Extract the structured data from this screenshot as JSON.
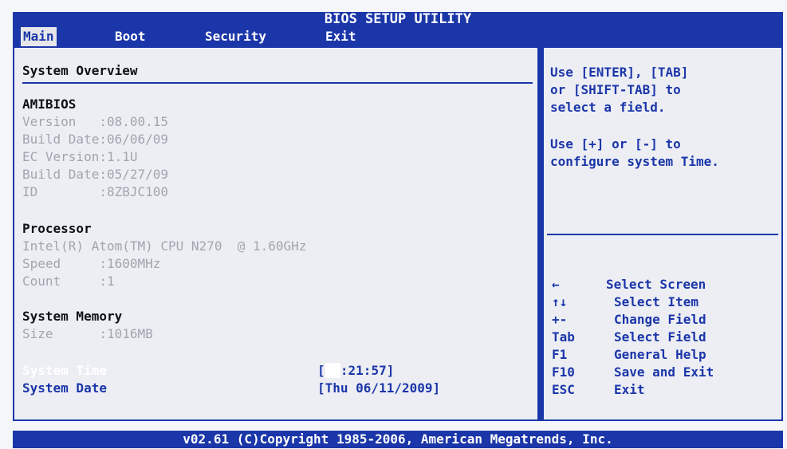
{
  "title": "BIOS SETUP UTILITY",
  "menu": [
    {
      "label": "Main"
    },
    {
      "label": "Boot"
    },
    {
      "label": "Security"
    },
    {
      "label": "Exit"
    }
  ],
  "overview": {
    "heading": "System Overview",
    "amibios": {
      "heading": "AMIBIOS",
      "version_label": "Version   :",
      "version_value": "08.00.15",
      "build_date_label": "Build Date:",
      "build_date_value": "06/06/09",
      "ec_version_label": "EC Version:",
      "ec_version_value": "1.1U",
      "ec_build_date_label": "Build Date:",
      "ec_build_date_value": "05/27/09",
      "id_label": "ID        :",
      "id_value": "8ZBJC100"
    },
    "processor": {
      "heading": "Processor",
      "name": "Intel(R) Atom(TM) CPU N270  @ 1.60GHz",
      "speed_label": "Speed     :",
      "speed_value": "1600MHz",
      "count_label": "Count     :",
      "count_value": "1"
    },
    "memory": {
      "heading": "System Memory",
      "size_label": "Size      :",
      "size_value": "1016MB"
    },
    "system_time_label": "System Time",
    "system_time_value_open": "[",
    "system_time_highlight": "14",
    "system_time_value_rest": ":21:57]",
    "system_date_label": "System Date",
    "system_date_value": "[Thu 06/11/2009]"
  },
  "help": {
    "line1": "Use [ENTER], [TAB]",
    "line2": "or [SHIFT-TAB] to",
    "line3": "select a field.",
    "line4": "Use [+] or [-] to",
    "line5": "configure system Time.",
    "keys": [
      {
        "key": "←",
        "desc": "Select Screen"
      },
      {
        "key": "↑↓",
        "desc": "Select Item"
      },
      {
        "key": "+-",
        "desc": "Change Field"
      },
      {
        "key": "Tab",
        "desc": "Select Field"
      },
      {
        "key": "F1",
        "desc": "General Help"
      },
      {
        "key": "F10",
        "desc": "Save and Exit"
      },
      {
        "key": "ESC",
        "desc": "Exit"
      }
    ]
  },
  "footer": "v02.61 (C)Copyright 1985-2006, American Megatrends, Inc."
}
